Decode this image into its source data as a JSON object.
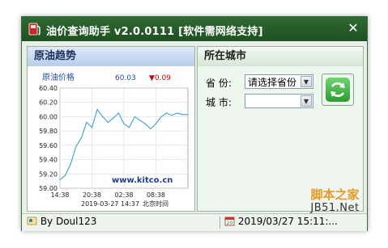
{
  "window": {
    "title": "油价查询助手 v2.0.0111 [软件需网络支持]",
    "close_symbol": "✕"
  },
  "crude": {
    "header": "原油趋势",
    "chart_title": "原油价格",
    "price": "60.03",
    "change": "▼0.09",
    "watermark_url": "www.kitco.cn",
    "timestamp": "2019-03-27 14:37",
    "timezone_label": "北京时间",
    "chart_data": {
      "type": "line",
      "title": "原油价格",
      "xlabel": "",
      "ylabel": "",
      "ylim": [
        59.0,
        60.4
      ],
      "y_ticks": [
        "60.40",
        "60.20",
        "60.00",
        "59.80",
        "59.60",
        "59.40",
        "59.20",
        "59.00"
      ],
      "x_ticks": [
        "14:38",
        "20:38",
        "02:38",
        "08:38"
      ],
      "x": [
        "14:38",
        "15:38",
        "16:38",
        "17:38",
        "18:38",
        "19:38",
        "20:38",
        "21:38",
        "22:38",
        "23:38",
        "00:38",
        "01:38",
        "02:38",
        "03:38",
        "04:38",
        "05:38",
        "06:38",
        "07:38",
        "08:38",
        "09:38",
        "10:38",
        "11:38",
        "12:38",
        "13:38",
        "14:37"
      ],
      "values": [
        59.12,
        59.18,
        59.34,
        59.58,
        59.7,
        59.92,
        59.85,
        60.1,
        60.0,
        59.92,
        59.98,
        60.05,
        59.9,
        59.85,
        60.0,
        59.95,
        59.9,
        59.83,
        59.9,
        60.0,
        60.05,
        60.02,
        60.05,
        60.03,
        60.03
      ],
      "grid": true,
      "line_color": "#3f9fd0"
    }
  },
  "city": {
    "header": "所在城市",
    "province_label": "省 份:",
    "province_value": "请选择省份",
    "city_label": "城 市:",
    "city_value": "",
    "refresh_icon": "refresh-icon"
  },
  "status": {
    "author": "By Doul123",
    "datetime": "2019/03/27 15:11:..."
  },
  "watermark": {
    "line1": "脚本之家",
    "line2": "JB51.Net"
  },
  "colors": {
    "titlebar": "#2f6a32",
    "accent_red": "#cc0000",
    "price_blue": "#2050a0",
    "refresh_green": "#3dba3d"
  }
}
